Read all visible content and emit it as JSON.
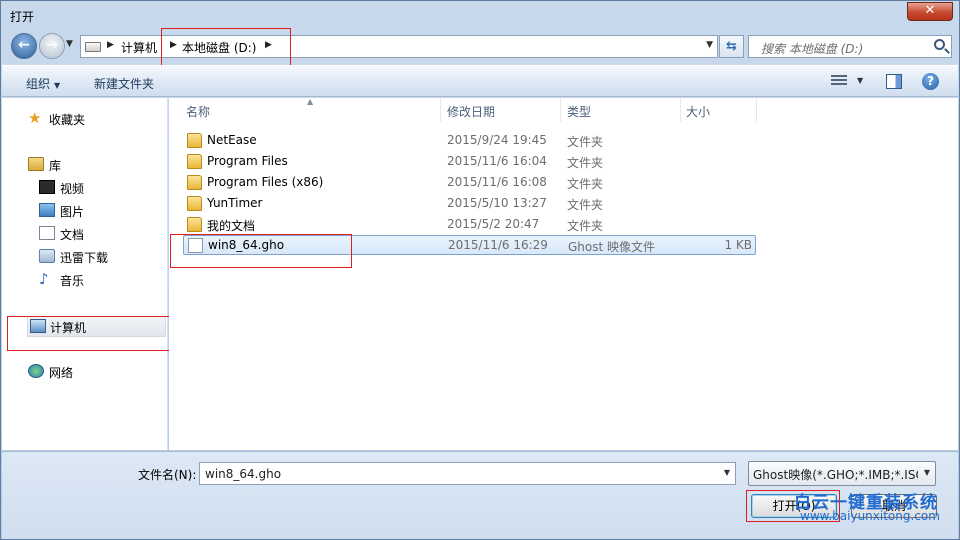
{
  "window": {
    "title": "打开",
    "close_label": "✕"
  },
  "address": {
    "breadcrumbs": [
      "计算机",
      "本地磁盘 (D:)"
    ],
    "search_placeholder": "搜索 本地磁盘 (D:)"
  },
  "toolbar": {
    "organize_label": "组织",
    "new_folder_label": "新建文件夹"
  },
  "nav": {
    "favorites": "收藏夹",
    "libraries": "库",
    "library_items": [
      "视频",
      "图片",
      "文档",
      "迅雷下载",
      "音乐"
    ],
    "computer": "计算机",
    "network": "网络"
  },
  "columns": {
    "name": "名称",
    "modified": "修改日期",
    "type": "类型",
    "size": "大小"
  },
  "files": [
    {
      "name": "NetEase",
      "modified": "2015/9/24 19:45",
      "type": "文件夹",
      "size": "",
      "icon": "folder-icon"
    },
    {
      "name": "Program Files",
      "modified": "2015/11/6 16:04",
      "type": "文件夹",
      "size": "",
      "icon": "folder-icon"
    },
    {
      "name": "Program Files (x86)",
      "modified": "2015/11/6 16:08",
      "type": "文件夹",
      "size": "",
      "icon": "folder-icon"
    },
    {
      "name": "YunTimer",
      "modified": "2015/5/10 13:27",
      "type": "文件夹",
      "size": "",
      "icon": "folder-icon"
    },
    {
      "name": "我的文档",
      "modified": "2015/5/2 20:47",
      "type": "文件夹",
      "size": "",
      "icon": "folder-icon"
    },
    {
      "name": "win8_64.gho",
      "modified": "2015/11/6 16:29",
      "type": "Ghost 映像文件",
      "size": "1 KB",
      "icon": "file-icon",
      "selected": true
    }
  ],
  "footer": {
    "filename_label": "文件名(N):",
    "filename_value": "win8_64.gho",
    "filetype_value": "Ghost映像(*.GHO;*.IMB;*.ISO",
    "open_label": "打开(O)",
    "cancel_label": "取消"
  },
  "watermark": {
    "title": "白云一键重装系统",
    "url": "www.baiyunxitong.com"
  },
  "colors": {
    "accent": "#1f6bd0",
    "highlight_box": "#e02020",
    "selection": "#d6e8fa"
  }
}
